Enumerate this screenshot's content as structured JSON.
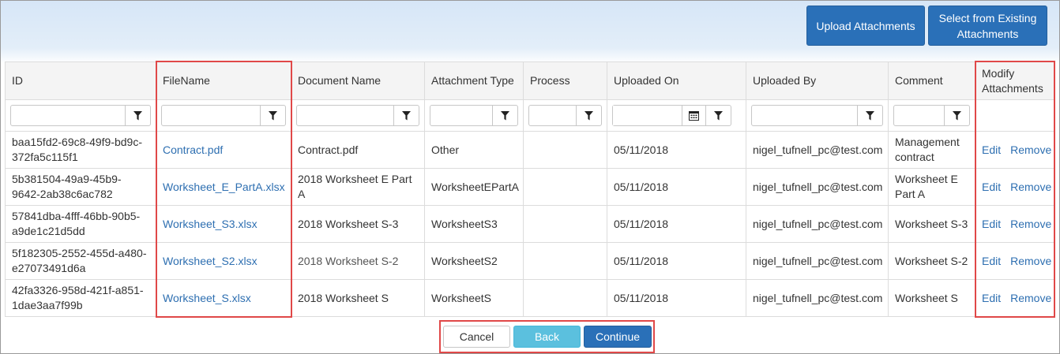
{
  "toolbar": {
    "upload_label": "Upload Attachments",
    "select_existing_label": "Select from Existing Attachments"
  },
  "table": {
    "columns": [
      "ID",
      "FileName",
      "Document Name",
      "Attachment Type",
      "Process",
      "Uploaded On",
      "Uploaded By",
      "Comment",
      "Modify Attachments"
    ],
    "rows": [
      {
        "id": "baa15fd2-69c8-49f9-bd9c-372fa5c115f1",
        "filename": "Contract.pdf",
        "document_name": "Contract.pdf",
        "attachment_type": "Other",
        "process": "",
        "uploaded_on": "05/11/2018",
        "uploaded_by": "nigel_tufnell_pc@test.com",
        "comment": "Management contract"
      },
      {
        "id": "5b381504-49a9-45b9-9642-2ab38c6ac782",
        "filename": "Worksheet_E_PartA.xlsx",
        "document_name": "2018 Worksheet E Part A",
        "attachment_type": "WorksheetEPartA",
        "process": "",
        "uploaded_on": "05/11/2018",
        "uploaded_by": "nigel_tufnell_pc@test.com",
        "comment": "Worksheet E Part A"
      },
      {
        "id": "57841dba-4fff-46bb-90b5-a9de1c21d5dd",
        "filename": "Worksheet_S3.xlsx",
        "document_name": "2018 Worksheet S-3",
        "attachment_type": "WorksheetS3",
        "process": "",
        "uploaded_on": "05/11/2018",
        "uploaded_by": "nigel_tufnell_pc@test.com",
        "comment": "Worksheet S-3"
      },
      {
        "id": "5f182305-2552-455d-a480-e27073491d6a",
        "filename": "Worksheet_S2.xlsx",
        "document_name": "2018 Worksheet S-2",
        "attachment_type": "WorksheetS2",
        "process": "",
        "uploaded_on": "05/11/2018",
        "uploaded_by": "nigel_tufnell_pc@test.com",
        "comment": "Worksheet S-2"
      },
      {
        "id": "42fa3326-958d-421f-a851-1dae3aa7f99b",
        "filename": "Worksheet_S.xlsx",
        "document_name": "2018 Worksheet S",
        "attachment_type": "WorksheetS",
        "process": "",
        "uploaded_on": "05/11/2018",
        "uploaded_by": "nigel_tufnell_pc@test.com",
        "comment": "Worksheet S"
      }
    ],
    "actions": {
      "edit_label": "Edit",
      "remove_label": "Remove"
    }
  },
  "footer": {
    "cancel_label": "Cancel",
    "back_label": "Back",
    "continue_label": "Continue"
  },
  "icons": {
    "filter": "filter-funnel-icon",
    "calendar": "calendar-icon"
  },
  "colors": {
    "primary": "#2a70b8",
    "info": "#5bc0de",
    "link": "#2e6fb1",
    "highlight": "#e04848"
  }
}
